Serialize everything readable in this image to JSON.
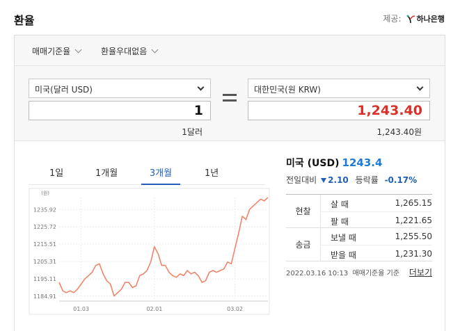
{
  "header": {
    "title": "환율",
    "provider_label": "제공:",
    "provider_name": "하나은행"
  },
  "filters": [
    {
      "label": "매매기준율"
    },
    {
      "label": "환율우대없음"
    }
  ],
  "converter": {
    "from_currency": "미국(달러 USD)",
    "from_amount": "1",
    "from_sub": "1달러",
    "to_currency": "대한민국(원 KRW)",
    "to_amount": "1,243.40",
    "to_sub": "1,243.40원"
  },
  "tabs": [
    {
      "label": "1일",
      "active": false
    },
    {
      "label": "1개월",
      "active": false
    },
    {
      "label": "3개월",
      "active": true
    },
    {
      "label": "1년",
      "active": false
    }
  ],
  "info": {
    "currency_label": "미국 (USD)",
    "rate": "1243.4",
    "change_label": "전일대비",
    "change_value": "2.10",
    "change_direction": "down",
    "rate_label": "등락률",
    "rate_change": "-0.17%",
    "cash": {
      "group": "현찰",
      "buy_label": "살 때",
      "buy_value": "1,265.15",
      "sell_label": "팔 때",
      "sell_value": "1,221.65"
    },
    "remit": {
      "group": "송금",
      "send_label": "보낼 때",
      "send_value": "1,255.50",
      "receive_label": "받을 때",
      "receive_value": "1,231.30"
    },
    "timestamp": "2022.03.16 10:13",
    "basis": "매매기준율 기준",
    "more_label": "더보기"
  },
  "chart_data": {
    "type": "line",
    "ylabel": "(원)",
    "yticks": [
      1184.91,
      1195.11,
      1205.31,
      1215.51,
      1225.72,
      1235.92
    ],
    "ylim": [
      1182,
      1243
    ],
    "xticks": [
      {
        "label": "01.03",
        "i": 6
      },
      {
        "label": "02.01",
        "i": 26
      },
      {
        "label": "03.02",
        "i": 48
      }
    ],
    "grid": true,
    "values": [
      1193,
      1188,
      1187,
      1188,
      1187,
      1189,
      1192,
      1195,
      1197,
      1199,
      1203,
      1204,
      1198,
      1194,
      1192,
      1185,
      1187,
      1189,
      1193,
      1193,
      1190,
      1191,
      1197,
      1198,
      1200,
      1205,
      1214,
      1210,
      1203,
      1203,
      1199,
      1197,
      1196,
      1198,
      1197,
      1200,
      1198,
      1199,
      1197,
      1193,
      1194,
      1199,
      1200,
      1199,
      1200,
      1201,
      1205,
      1204,
      1213,
      1222,
      1232,
      1230,
      1236,
      1238,
      1240,
      1242,
      1241,
      1243
    ],
    "color": "#f0846a"
  },
  "colors": {
    "accent": "#1f5fb8",
    "rate_blue": "#1f7bd8",
    "amount_red": "#d9302a",
    "line": "#f0846a"
  }
}
